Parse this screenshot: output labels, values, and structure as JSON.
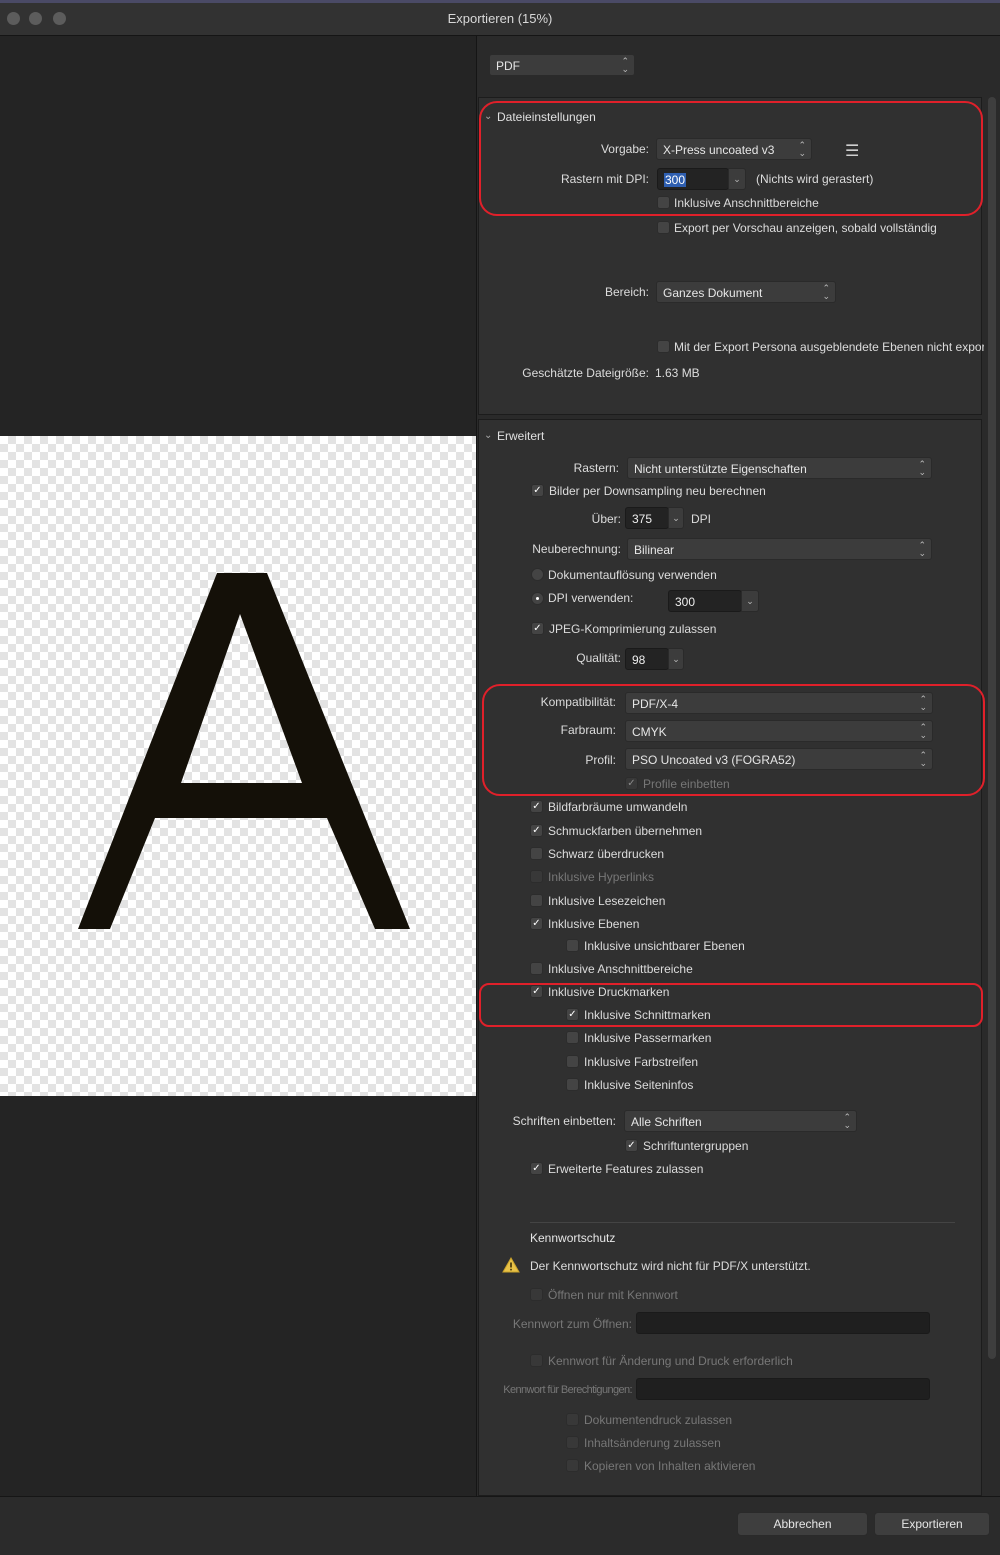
{
  "window": {
    "title": "Exportieren (15%)"
  },
  "preview": {
    "letter": "A"
  },
  "format": {
    "value": "PDF"
  },
  "file_settings": {
    "title": "Dateieinstellungen",
    "preset_label": "Vorgabe:",
    "preset_value": "X-Press uncoated v3",
    "raster_dpi_label": "Rastern mit DPI:",
    "raster_dpi_value": "300",
    "raster_note": "(Nichts wird gerastert)",
    "include_bleed": "Inklusive Anschnittbereiche",
    "preview_export": "Export per Vorschau anzeigen, sobald vollständig",
    "area_label": "Bereich:",
    "area_value": "Ganzes Dokument",
    "hidden_layers": "Mit der Export Persona ausgeblendete Ebenen nicht exportieren",
    "file_size_label": "Geschätzte Dateigröße:",
    "file_size_value": "1.63 MB"
  },
  "advanced": {
    "title": "Erweitert",
    "raster_label": "Rastern:",
    "raster_value": "Nicht unterstützte Eigenschaften",
    "downsample": "Bilder per Downsampling neu berechnen",
    "above_label": "Über:",
    "above_value": "375",
    "above_unit": "DPI",
    "resample_label": "Neuberechnung:",
    "resample_value": "Bilinear",
    "doc_resolution": "Dokumentauflösung verwenden",
    "use_dpi": "DPI verwenden:",
    "use_dpi_value": "300",
    "jpeg": "JPEG-Komprimierung zulassen",
    "quality_label": "Qualität:",
    "quality_value": "98",
    "compat_label": "Kompatibilität:",
    "compat_value": "PDF/X-4",
    "colorspace_label": "Farbraum:",
    "colorspace_value": "CMYK",
    "profile_label": "Profil:",
    "profile_value": "PSO Uncoated v3 (FOGRA52)",
    "embed_profile": "Profile einbetten",
    "convert_image_spaces": "Bildfarbräume umwandeln",
    "spot_colors": "Schmuckfarben übernehmen",
    "overprint_black": "Schwarz überdrucken",
    "hyperlinks": "Inklusive Hyperlinks",
    "bookmarks": "Inklusive Lesezeichen",
    "layers": "Inklusive Ebenen",
    "hidden_layers": "Inklusive unsichtbarer Ebenen",
    "bleed": "Inklusive Anschnittbereiche",
    "printer_marks": "Inklusive Druckmarken",
    "crop_marks": "Inklusive Schnittmarken",
    "registration_marks": "Inklusive Passermarken",
    "color_bars": "Inklusive Farbstreifen",
    "page_info": "Inklusive Seiteninfos",
    "embed_fonts_label": "Schriften einbetten:",
    "embed_fonts_value": "Alle Schriften",
    "font_subsets": "Schriftuntergruppen",
    "advanced_features": "Erweiterte Features zulassen"
  },
  "password": {
    "title": "Kennwortschutz",
    "warning": "Der Kennwortschutz wird nicht für PDF/X unterstützt.",
    "open_with_password": "Öffnen nur mit Kennwort",
    "open_password_label": "Kennwort zum Öffnen:",
    "change_print_required": "Kennwort für Änderung und Druck erforderlich",
    "permissions_label": "Kennwort für Berechtigungen:",
    "allow_print": "Dokumentendruck zulassen",
    "allow_changes": "Inhaltsänderung zulassen",
    "allow_copy": "Kopieren von Inhalten aktivieren"
  },
  "footer": {
    "cancel": "Abbrechen",
    "export": "Exportieren"
  },
  "colors": {
    "highlight": "#e0202a",
    "panel": "#303030",
    "background": "#242424"
  }
}
